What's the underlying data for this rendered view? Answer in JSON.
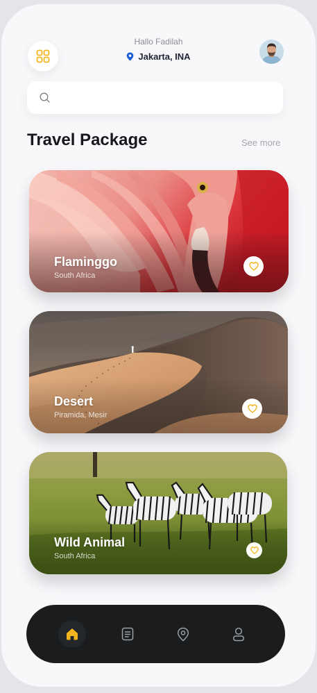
{
  "header": {
    "greeting": "Hallo Fadilah",
    "location": "Jakarta, INA",
    "accent": "#f5b51e",
    "location_pin_color": "#1a5fd8"
  },
  "search": {
    "placeholder": ""
  },
  "section": {
    "title": "Travel Package",
    "see_more": "See more"
  },
  "packages": [
    {
      "name": "Flaminggo",
      "location": "South Africa"
    },
    {
      "name": "Desert",
      "location": "Piramida, Mesir"
    },
    {
      "name": "Wild Animal",
      "location": "South Africa"
    }
  ],
  "icons": {
    "menu": "grid-icon",
    "pin": "location-pin-icon",
    "search": "search-icon",
    "favorite": "heart-icon",
    "home": "home-icon",
    "list": "document-icon",
    "map": "map-pin-icon",
    "profile": "user-icon"
  },
  "nav": {
    "active": "home",
    "active_color": "#f5b51e",
    "inactive_color": "#9aa0a6"
  }
}
